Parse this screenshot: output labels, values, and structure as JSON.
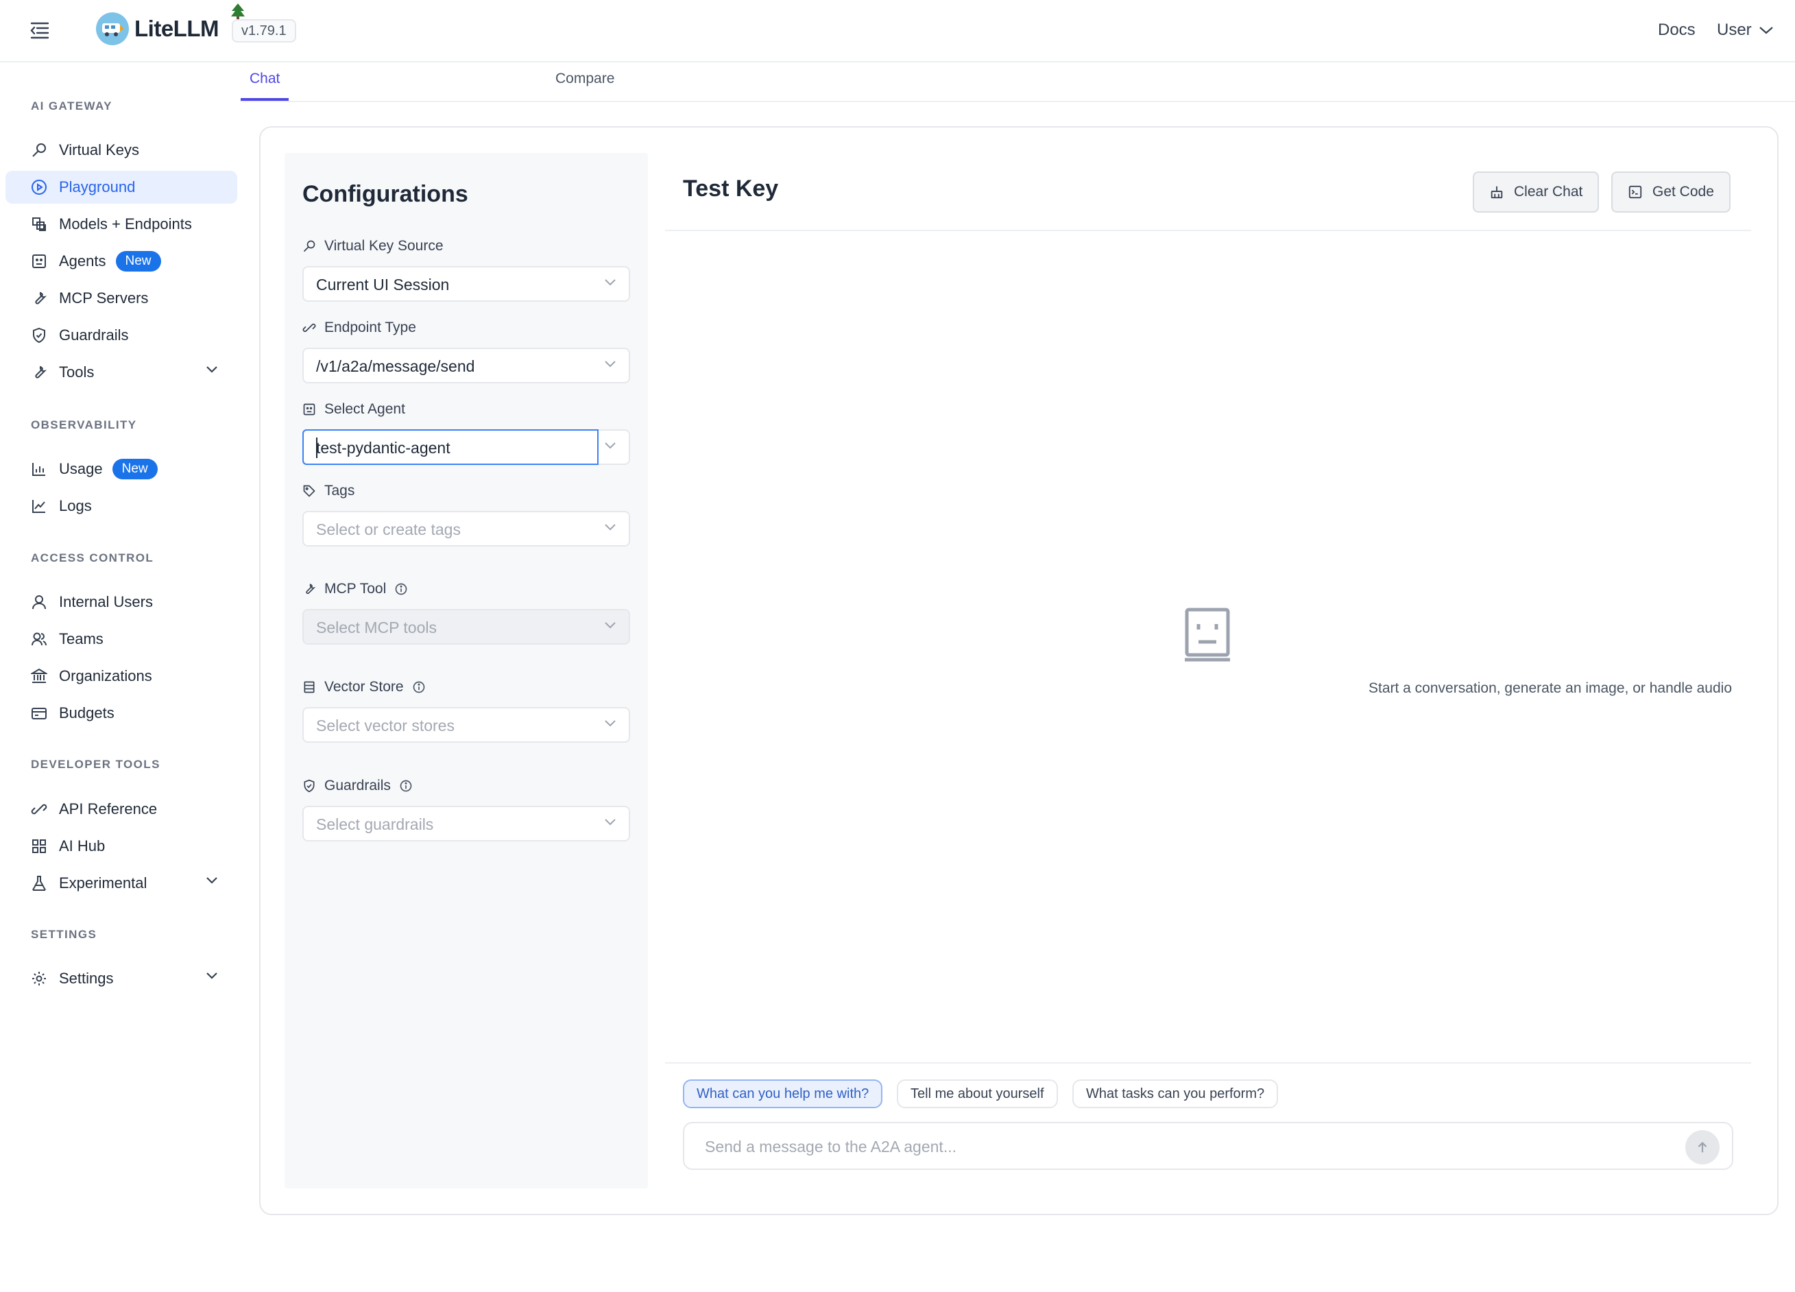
{
  "header": {
    "logo_text": "LiteLLM",
    "version": "v1.79.1",
    "docs_label": "Docs",
    "user_label": "User"
  },
  "sidebar": {
    "sections": {
      "ai_gateway": "AI GATEWAY",
      "observability": "OBSERVABILITY",
      "access_control": "ACCESS CONTROL",
      "developer_tools": "DEVELOPER TOOLS",
      "settings": "SETTINGS"
    },
    "items": {
      "virtual_keys": "Virtual Keys",
      "playground": "Playground",
      "models_endpoints": "Models + Endpoints",
      "agents": "Agents",
      "agents_badge": "New",
      "mcp_servers": "MCP Servers",
      "guardrails": "Guardrails",
      "tools": "Tools",
      "usage": "Usage",
      "usage_badge": "New",
      "logs": "Logs",
      "internal_users": "Internal Users",
      "teams": "Teams",
      "organizations": "Organizations",
      "budgets": "Budgets",
      "api_reference": "API Reference",
      "ai_hub": "AI Hub",
      "experimental": "Experimental",
      "settings": "Settings"
    }
  },
  "tabs": {
    "chat": "Chat",
    "compare": "Compare"
  },
  "config": {
    "title": "Configurations",
    "virtual_key_source": {
      "label": "Virtual Key Source",
      "value": "Current UI Session"
    },
    "endpoint_type": {
      "label": "Endpoint Type",
      "value": "/v1/a2a/message/send"
    },
    "select_agent": {
      "label": "Select Agent",
      "value": "test-pydantic-agent"
    },
    "tags": {
      "label": "Tags",
      "placeholder": "Select or create tags"
    },
    "mcp_tool": {
      "label": "MCP Tool",
      "placeholder": "Select MCP tools"
    },
    "vector_store": {
      "label": "Vector Store",
      "placeholder": "Select vector stores"
    },
    "guardrails": {
      "label": "Guardrails",
      "placeholder": "Select guardrails"
    }
  },
  "chat": {
    "title": "Test Key",
    "clear_chat": "Clear Chat",
    "get_code": "Get Code",
    "empty_text": "Start a conversation, generate an image, or handle audio",
    "suggestions": [
      "What can you help me with?",
      "Tell me about yourself",
      "What tasks can you perform?"
    ],
    "input_placeholder": "Send a message to the A2A agent..."
  },
  "colors": {
    "accent": "#4f46e5",
    "active_nav_bg": "#e8efff",
    "badge": "#1a73e8"
  }
}
